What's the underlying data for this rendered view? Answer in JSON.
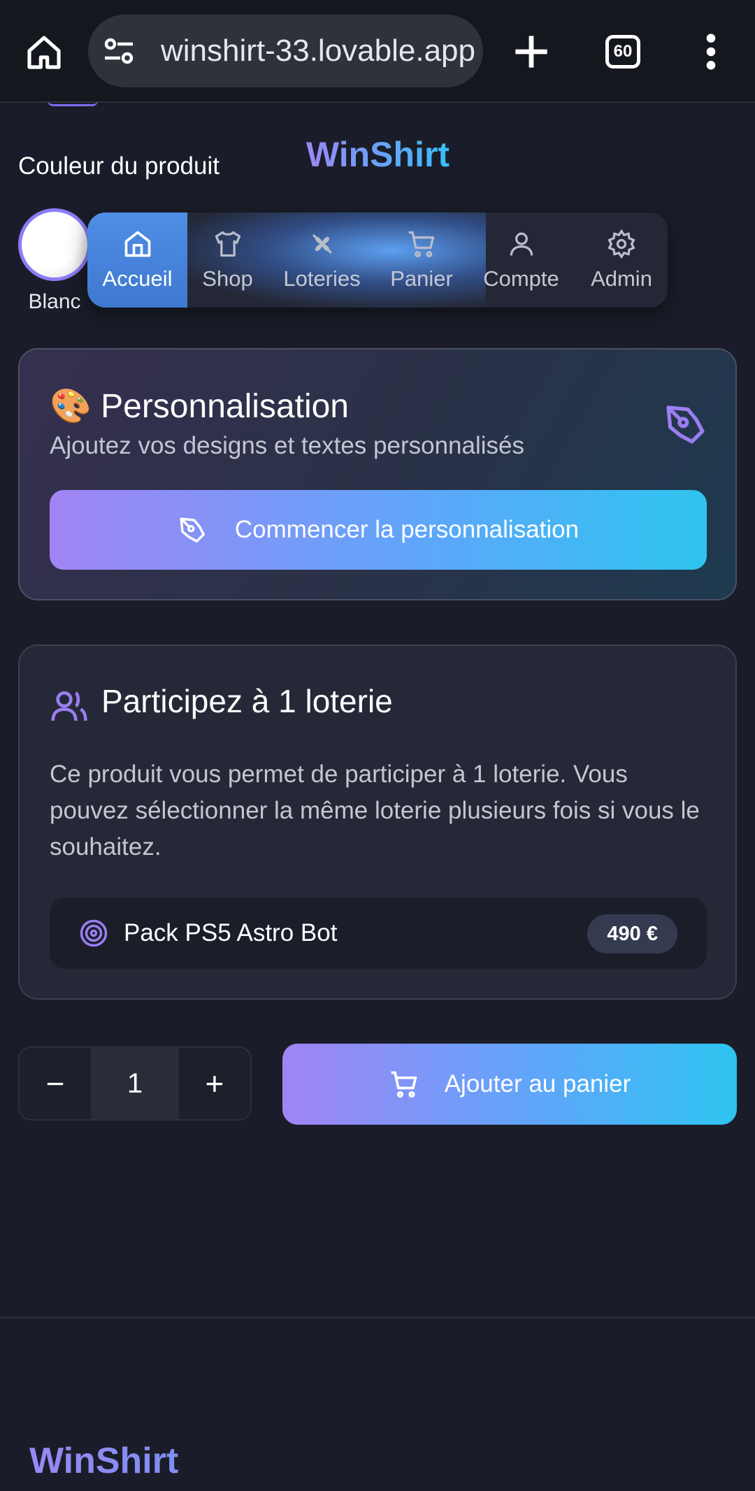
{
  "browser": {
    "url": "winshirt-33.lovable.app",
    "tab_count": "60"
  },
  "brand": "WinShirt",
  "product": {
    "color_label": "Couleur du produit",
    "selected_color": "Blanc"
  },
  "nav": {
    "items": [
      {
        "label": "Accueil",
        "icon": "home-icon",
        "active": true
      },
      {
        "label": "Shop",
        "icon": "shirt-icon"
      },
      {
        "label": "Loteries",
        "icon": "clover-icon"
      },
      {
        "label": "Panier",
        "icon": "cart-icon"
      },
      {
        "label": "Compte",
        "icon": "user-icon"
      },
      {
        "label": "Admin",
        "icon": "gear-icon"
      }
    ]
  },
  "personalisation": {
    "emoji": "🎨",
    "title": "Personnalisation",
    "subtitle": "Ajoutez vos designs et textes personnalisés",
    "button_label": "Commencer la personnalisation"
  },
  "lottery": {
    "title": "Participez à 1 loterie",
    "description": "Ce produit vous permet de participer à 1 loterie. Vous pouvez sélectionner la même loterie plusieurs fois si vous le souhaitez.",
    "item_name": "Pack PS5 Astro Bot",
    "item_price": "490 €"
  },
  "cart": {
    "quantity": "1",
    "minus": "−",
    "plus": "+",
    "add_label": "Ajouter au panier"
  },
  "footer": {
    "brand": "WinShirt"
  },
  "colors": {
    "accent_purple": "#a184f3",
    "accent_cyan": "#2ec4ef",
    "background": "#1a1d29"
  }
}
